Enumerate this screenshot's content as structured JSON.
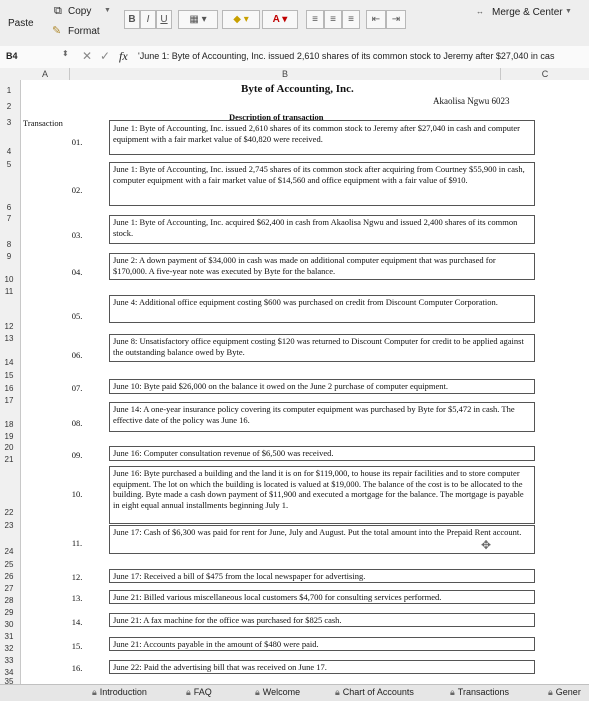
{
  "toolbar": {
    "paste_label": "Paste",
    "copy_label": "Copy",
    "format_label": "Format",
    "bold_label": "B",
    "italic_label": "I",
    "underline_label": "U",
    "merge_label": "Merge & Center"
  },
  "formula_bar": {
    "cell_ref": "B4",
    "fx_label": "fx",
    "content": "'June 1: Byte of Accounting, Inc. issued 2,610 shares of its common stock to Jeremy after $27,040 in cas"
  },
  "columns": [
    "A",
    "B",
    "C"
  ],
  "rows": [
    "1",
    "2",
    "3",
    "4",
    "5",
    "6",
    "7",
    "8",
    "9",
    "10",
    "11",
    "12",
    "13",
    "14",
    "15",
    "16",
    "17",
    "18",
    "19",
    "20",
    "21",
    "22",
    "23",
    "24",
    "25",
    "26",
    "27",
    "28",
    "29",
    "30",
    "31",
    "32",
    "33",
    "34",
    "35"
  ],
  "sheet": {
    "title": "Byte of Accounting, Inc.",
    "author": "Akaolisa Ngwu 6023",
    "transaction_header": "Transaction",
    "description_header": "Description of transaction",
    "transactions": [
      {
        "num": "01.",
        "text": "June 1: Byte of Accounting, Inc. issued 2,610 shares of its common stock to Jeremy after $27,040 in cash and computer equipment with a fair market value of $40,820 were received."
      },
      {
        "num": "02.",
        "text": "June 1: Byte of Accounting, Inc. issued 2,745 shares of its common stock after acquiring from Courtney $55,900 in cash, computer equipment with a fair market value of $14,560 and office equipment with a fair value of $910."
      },
      {
        "num": "03.",
        "text": "June 1: Byte of Accounting, Inc. acquired $62,400 in cash from Akaolisa Ngwu and issued 2,400 shares of its common stock."
      },
      {
        "num": "04.",
        "text": "June 2: A down payment of $34,000 in cash was made on additional computer equipment that was purchased for $170,000. A five-year note was executed by Byte for the balance."
      },
      {
        "num": "05.",
        "text": "June 4: Additional office equipment costing $600 was purchased on credit from Discount Computer Corporation."
      },
      {
        "num": "06.",
        "text": "June 8: Unsatisfactory office equipment costing $120 was returned to Discount Computer for credit to be applied against the outstanding balance owed by Byte."
      },
      {
        "num": "07.",
        "text": "June 10: Byte paid $26,000 on the balance it owed on the June 2 purchase of computer equipment."
      },
      {
        "num": "08.",
        "text": "June 14: A one-year insurance policy covering its computer equipment was purchased by Byte for $5,472 in cash. The effective date of the policy was June 16."
      },
      {
        "num": "09.",
        "text": "June 16: Computer consultation revenue of $6,500 was received."
      },
      {
        "num": "10.",
        "text": "June 16: Byte purchased a building and the land it is on for $119,000, to house its repair facilities and to store computer equipment. The lot on which the building is located is valued at $19,000. The balance of the cost is to be allocated to the building. Byte made a cash down payment of $11,900 and executed a mortgage for the balance. The mortgage is payable in eight equal annual installments beginning July 1."
      },
      {
        "num": "11.",
        "text": "June 17: Cash of $6,300 was paid for rent for June, July and August. Put the total amount into the Prepaid Rent account."
      },
      {
        "num": "12.",
        "text": "June 17: Received a bill of $475 from the local newspaper for advertising."
      },
      {
        "num": "13.",
        "text": "June 21: Billed various miscellaneous local customers $4,700 for consulting services performed."
      },
      {
        "num": "14.",
        "text": "June 21: A fax machine for the office was purchased for $825 cash."
      },
      {
        "num": "15.",
        "text": "June 21: Accounts payable in the amount of $480 were paid."
      },
      {
        "num": "16.",
        "text": "June 22: Paid the advertising bill that was received on June 17."
      }
    ]
  },
  "tabs": [
    "Introduction",
    "FAQ",
    "Welcome",
    "Chart of Accounts",
    "Transactions",
    "Gener"
  ]
}
